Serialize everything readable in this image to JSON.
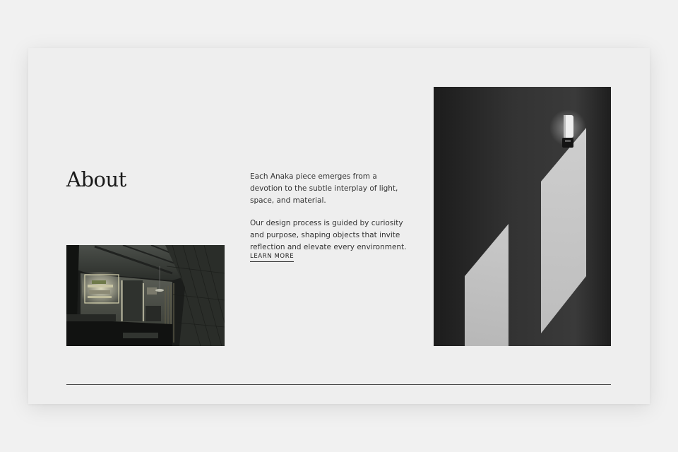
{
  "about": {
    "title": "About",
    "paragraphs": [
      "Each Anaka piece emerges from a devotion to the subtle interplay of light, space, and material.",
      "Our design process is guided by curiosity and purpose, shaping objects that invite reflection and elevate every environment."
    ],
    "cta_label": "LEARN MORE"
  },
  "images": {
    "interior": "dark-interior-photo",
    "wall": "wall-light-shadow-photo"
  },
  "colors": {
    "background": "#f1f1f1",
    "card": "#eeeeee",
    "text": "#333333",
    "heading": "#1a1a1a",
    "rule": "#4a4a4a"
  }
}
